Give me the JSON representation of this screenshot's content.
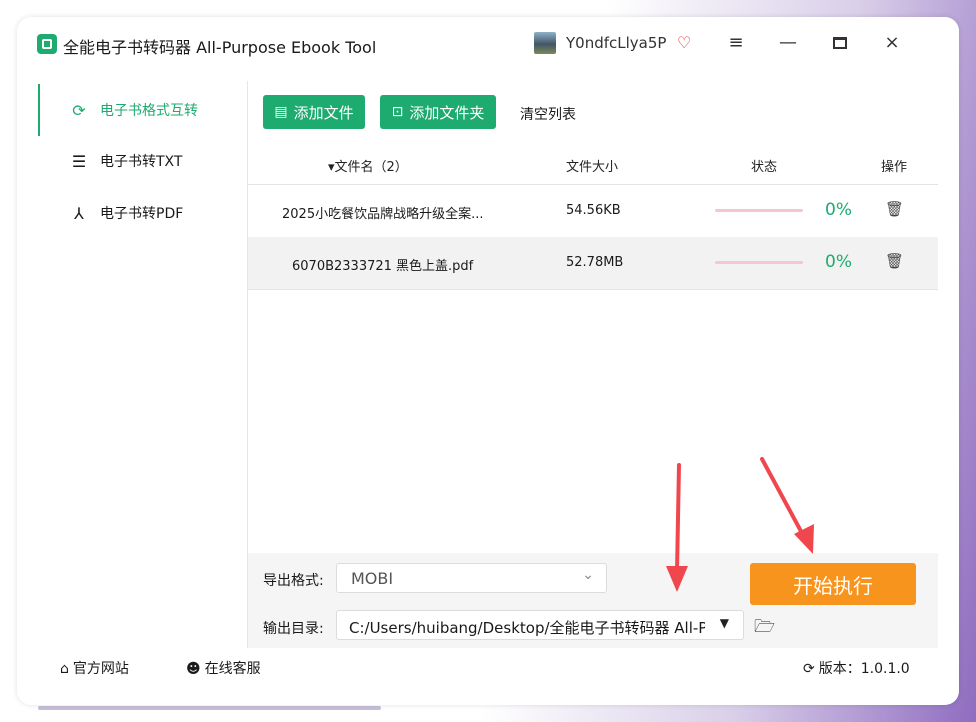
{
  "app": {
    "title": "全能电子书转码器 All-Purpose Ebook Tool",
    "icon": "app-logo-icon",
    "username": "Y0ndfcLlya5P",
    "window_controls": [
      "menu-icon",
      "minimize-icon",
      "maximize-icon",
      "close-icon"
    ],
    "menu_glyph": "≡",
    "min_glyph": "—",
    "close_glyph": "×"
  },
  "sidebar": {
    "items": [
      {
        "label": "电子书格式互转",
        "icon": "refresh-icon",
        "glyph": "⟳",
        "active": true
      },
      {
        "label": "电子书转TXT",
        "icon": "document-icon",
        "glyph": "☰",
        "active": false
      },
      {
        "label": "电子书转PDF",
        "icon": "pdf-icon",
        "glyph": "⅄",
        "active": false
      }
    ]
  },
  "toolbar": {
    "add_file": "添加文件",
    "add_folder": "添加文件夹",
    "clear_list": "清空列表"
  },
  "table": {
    "headers": {
      "name": "▾文件名（2）",
      "size": "文件大小",
      "status": "状态",
      "action": "操作"
    },
    "rows": [
      {
        "name": "2025小吃餐饮品牌战略升级全案...",
        "size": "54.56KB",
        "progress": "0%",
        "progress_fraction": 0
      },
      {
        "name": "6070B2333721 黑色上盖.pdf",
        "size": "52.78MB",
        "progress": "0%",
        "progress_fraction": 0
      }
    ]
  },
  "bottom": {
    "format_label": "导出格式:",
    "format_value": "MOBI",
    "output_label": "输出目录:",
    "output_value": "C:/Users/huibang/Desktop/全能电子书转码器 All-Pu",
    "start_button": "开始执行"
  },
  "statusbar": {
    "website": "官方网站",
    "service": "在线客服",
    "version": "版本：1.0.1.0"
  },
  "colors": {
    "accent_green": "#1dab6f",
    "start_orange": "#f7941d",
    "annotation_red": "#f0464e"
  }
}
